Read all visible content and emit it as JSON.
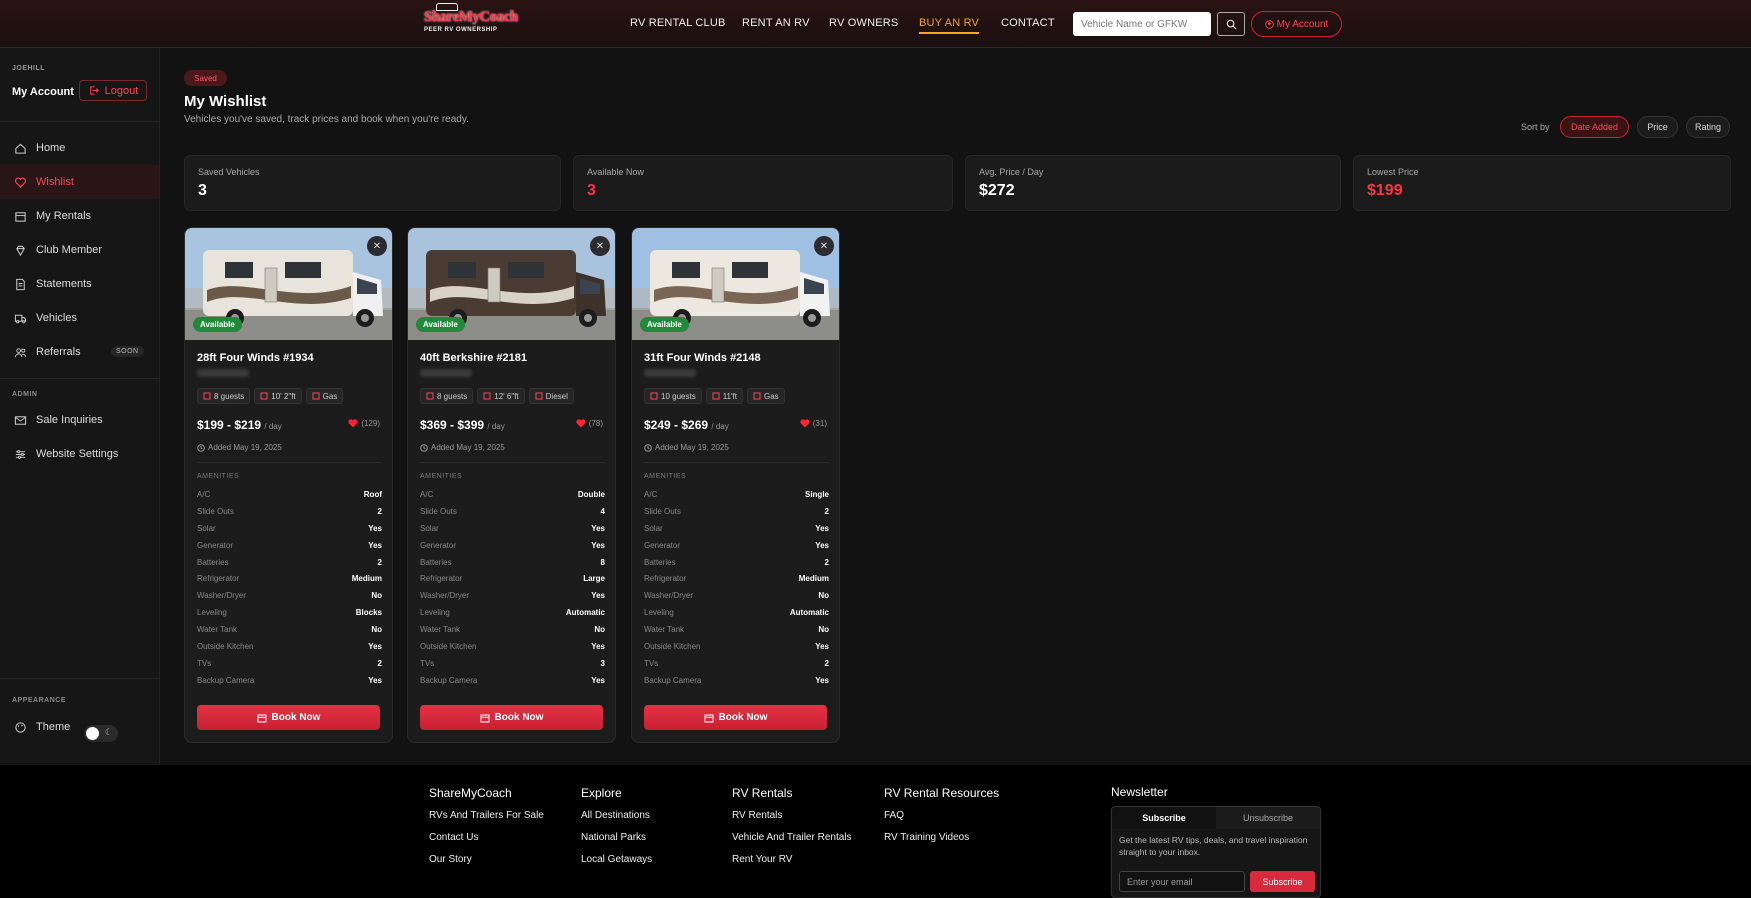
{
  "header": {
    "logo_text": "ShareMyCoach",
    "logo_tagline": "PEER RV OWNERSHIP",
    "nav": [
      {
        "label": "RV RENTAL CLUB"
      },
      {
        "label": "RENT AN RV"
      },
      {
        "label": "RV OWNERS"
      },
      {
        "label": "BUY AN RV"
      },
      {
        "label": "CONTACT"
      }
    ],
    "search_placeholder": "Vehicle Name or GFKW",
    "account_label": "My Account",
    "accent": "#ff3344",
    "active_nav_color": "#f5a623"
  },
  "sidebar": {
    "username": "JOEHILL",
    "account_label": "My Account",
    "logout_label": "Logout",
    "items": [
      {
        "label": "Home",
        "icon": "home-icon"
      },
      {
        "label": "Wishlist",
        "icon": "heart-icon"
      },
      {
        "label": "My Rentals",
        "icon": "calendar-icon"
      },
      {
        "label": "Club Member",
        "icon": "diamond-icon"
      },
      {
        "label": "Statements",
        "icon": "document-icon"
      },
      {
        "label": "Vehicles",
        "icon": "truck-icon"
      },
      {
        "label": "Referrals",
        "icon": "users-icon",
        "badge": "SOON"
      }
    ],
    "admin_label": "ADMIN",
    "admin_items": [
      {
        "label": "Sale Inquiries",
        "icon": "mail-icon"
      },
      {
        "label": "Website Settings",
        "icon": "sliders-icon"
      }
    ],
    "appearance_label": "APPEARANCE",
    "theme_label": "Theme"
  },
  "main": {
    "badge": "Saved",
    "title": "My Wishlist",
    "subtitle": "Vehicles you've saved, track prices and book when you're ready.",
    "sort_label": "Sort by",
    "sort_options": [
      {
        "label": "Date Added",
        "active": true
      },
      {
        "label": "Price",
        "active": false
      },
      {
        "label": "Rating",
        "active": false
      }
    ],
    "stats": [
      {
        "label": "Saved Vehicles",
        "value": "3"
      },
      {
        "label": "Available Now",
        "value": "3"
      },
      {
        "label": "Avg. Price / Day",
        "value": "$272"
      },
      {
        "label": "Lowest Price",
        "value": "$199"
      }
    ],
    "amenities_label": "AMENITIES",
    "book_label": "Book Now",
    "per_day": "/ day",
    "cards": [
      {
        "status": "Available",
        "title": "28ft Four Winds #1934",
        "chips": [
          "8 guests",
          "10' 2\"ft",
          "Gas"
        ],
        "price": "$199 - $219",
        "likes": "(129)",
        "added": "Added May 19, 2025",
        "amenities": [
          {
            "k": "A/C",
            "v": "Roof"
          },
          {
            "k": "Slide Outs",
            "v": "2"
          },
          {
            "k": "Solar",
            "v": "Yes"
          },
          {
            "k": "Generator",
            "v": "Yes"
          },
          {
            "k": "Batteries",
            "v": "2"
          },
          {
            "k": "Refrigerator",
            "v": "Medium"
          },
          {
            "k": "Washer/Dryer",
            "v": "No"
          },
          {
            "k": "Leveling",
            "v": "Blocks"
          },
          {
            "k": "Water Tank",
            "v": "No"
          },
          {
            "k": "Outside Kitchen",
            "v": "Yes"
          },
          {
            "k": "TVs",
            "v": "2"
          },
          {
            "k": "Backup Camera",
            "v": "Yes"
          }
        ]
      },
      {
        "status": "Available",
        "title": "40ft Berkshire #2181",
        "chips": [
          "8 guests",
          "12' 6\"ft",
          "Diesel"
        ],
        "price": "$369 - $399",
        "likes": "(78)",
        "added": "Added May 19, 2025",
        "amenities": [
          {
            "k": "A/C",
            "v": "Double"
          },
          {
            "k": "Slide Outs",
            "v": "4"
          },
          {
            "k": "Solar",
            "v": "Yes"
          },
          {
            "k": "Generator",
            "v": "Yes"
          },
          {
            "k": "Batteries",
            "v": "8"
          },
          {
            "k": "Refrigerator",
            "v": "Large"
          },
          {
            "k": "Washer/Dryer",
            "v": "Yes"
          },
          {
            "k": "Leveling",
            "v": "Automatic"
          },
          {
            "k": "Water Tank",
            "v": "No"
          },
          {
            "k": "Outside Kitchen",
            "v": "Yes"
          },
          {
            "k": "TVs",
            "v": "3"
          },
          {
            "k": "Backup Camera",
            "v": "Yes"
          }
        ]
      },
      {
        "status": "Available",
        "title": "31ft Four Winds #2148",
        "chips": [
          "10 guests",
          "11'ft",
          "Gas"
        ],
        "price": "$249 - $269",
        "likes": "(31)",
        "added": "Added May 19, 2025",
        "amenities": [
          {
            "k": "A/C",
            "v": "Single"
          },
          {
            "k": "Slide Outs",
            "v": "2"
          },
          {
            "k": "Solar",
            "v": "Yes"
          },
          {
            "k": "Generator",
            "v": "Yes"
          },
          {
            "k": "Batteries",
            "v": "2"
          },
          {
            "k": "Refrigerator",
            "v": "Medium"
          },
          {
            "k": "Washer/Dryer",
            "v": "No"
          },
          {
            "k": "Leveling",
            "v": "Automatic"
          },
          {
            "k": "Water Tank",
            "v": "No"
          },
          {
            "k": "Outside Kitchen",
            "v": "Yes"
          },
          {
            "k": "TVs",
            "v": "2"
          },
          {
            "k": "Backup Camera",
            "v": "Yes"
          }
        ]
      }
    ]
  },
  "footer": {
    "columns": [
      {
        "heading": "ShareMyCoach",
        "links": [
          "RVs And Trailers For Sale",
          "Contact Us",
          "Our Story"
        ]
      },
      {
        "heading": "Explore",
        "links": [
          "All Destinations",
          "National Parks",
          "Local Getaways"
        ]
      },
      {
        "heading": "RV Rentals",
        "links": [
          "RV Rentals",
          "Vehicle And Trailer Rentals",
          "Rent Your RV"
        ]
      },
      {
        "heading": "RV Rental Resources",
        "links": [
          "FAQ",
          "RV Training Videos"
        ]
      }
    ],
    "newsletter": {
      "title": "Newsletter",
      "tab_subscribe": "Subscribe",
      "tab_unsubscribe": "Unsubscribe",
      "text": "Get the latest RV tips, deals, and travel inspiration straight to your inbox.",
      "email_placeholder": "Enter your email",
      "button": "Subscribe"
    }
  }
}
